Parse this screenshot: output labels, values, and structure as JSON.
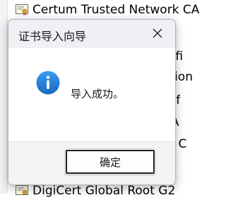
{
  "background": {
    "top_cert": "Certum Trusted Network CA",
    "bottom_cert": "DigiCert Global Root G2",
    "partial_texts": [
      "rtifi",
      "ation",
      "sof",
      "CA",
      "ot C"
    ]
  },
  "dialog": {
    "title": "证书导入向导",
    "close_glyph": "✕",
    "message": "导入成功。",
    "ok_label": "确定",
    "info_glyph": "i"
  },
  "colors": {
    "accent": "#1a73c8",
    "info_icon": "#1e7fd6",
    "titlebar": "#eef0f5",
    "footer": "#f3f3f3"
  }
}
